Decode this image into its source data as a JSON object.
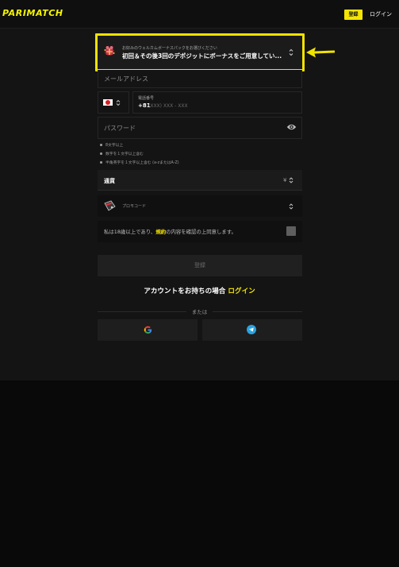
{
  "header": {
    "logo": "PARIMATCH",
    "register_label": "登録",
    "login_label": "ログイン"
  },
  "bonus": {
    "caption": "お好みのウェルカムボーナスパックをお選びください",
    "title": "初回＆その後3回のデポジットにボーナスをご用意してい..."
  },
  "form": {
    "email_placeholder": "メールアドレス",
    "phone": {
      "label": "電話番号",
      "code": "+81",
      "placeholder": "(XXX) XXX - XXX"
    },
    "password_placeholder": "パスワード",
    "password_rules": [
      "8文字以上",
      "数字を１文字以上含む",
      "半角英字を１文字以上含む (a-zまたはA-Z)"
    ],
    "currency": {
      "label": "通貨",
      "symbol": "¥"
    },
    "promo_label": "プロモコード",
    "agreement": {
      "before": "私は18歳以上であり、",
      "link": "規約",
      "after": "の内容を確認の上同意します。"
    },
    "submit_label": "登録"
  },
  "footer": {
    "have_account": "アカウントをお持ちの場合",
    "login_link": "ログイン",
    "or_label": "または"
  },
  "social": [
    "google-icon",
    "telegram-icon"
  ],
  "colors": {
    "accent": "#f5e500",
    "background": "#141414",
    "highlight_box": "#f1e300",
    "telegram": "#2aa3e0"
  }
}
